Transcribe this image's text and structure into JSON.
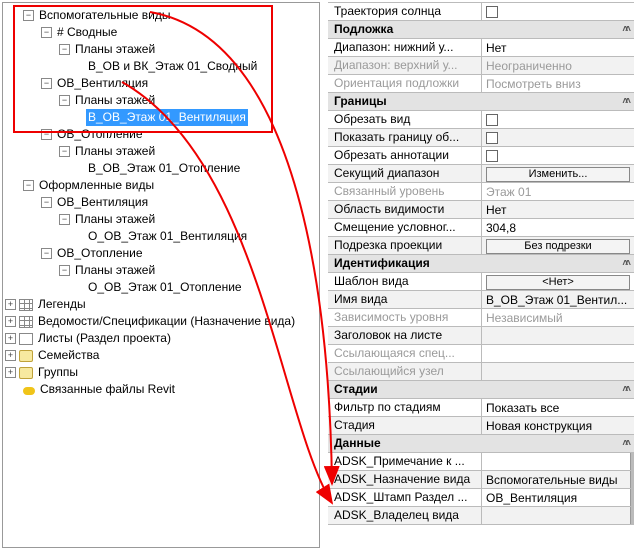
{
  "tree": {
    "n0": "Вспомогательные виды",
    "n1": "# Сводные",
    "n2": "Планы этажей",
    "n3": "В_ОВ и ВК_Этаж 01_Сводный",
    "n4": "ОВ_Вентиляция",
    "n5": "Планы этажей",
    "n6": "В_ОВ_Этаж 01_Вентиляция",
    "n7": "ОВ_Отопление",
    "n8": "Планы этажей",
    "n9": "В_ОВ_Этаж 01_Отопление",
    "n10": "Оформленные виды",
    "n11": "ОВ_Вентиляция",
    "n12": "Планы этажей",
    "n13": "О_ОВ_Этаж 01_Вентиляция",
    "n14": "ОВ_Отопление",
    "n15": "Планы этажей",
    "n16": "О_ОВ_Этаж 01_Отопление",
    "n17": "Легенды",
    "n18": "Ведомости/Спецификации (Назначение вида)",
    "n19": "Листы (Раздел проекта)",
    "n20": "Семейства",
    "n21": "Группы",
    "n22": "Связанные файлы Revit"
  },
  "props": {
    "r0n": "Траектория солнца",
    "r1c": "Подложка",
    "r1n": "Диапазон: нижний у...",
    "r1v": "Нет",
    "r2n": "Диапазон: верхний у...",
    "r2v": "Неограниченно",
    "r3n": "Ориентация подложки",
    "r3v": "Посмотреть вниз",
    "r4c": "Границы",
    "r4n": "Обрезать вид",
    "r5n": "Показать границу об...",
    "r6n": "Обрезать аннотации",
    "r7n": "Секущий диапазон",
    "r7v": "Изменить...",
    "r8n": "Связанный уровень",
    "r8v": "Этаж 01",
    "r9n": "Область видимости",
    "r9v": "Нет",
    "r10n": "Смещение условног...",
    "r10v": "304,8",
    "r11n": "Подрезка проекции",
    "r11v": "Без подрезки",
    "r12c": "Идентификация",
    "r12n": "Шаблон вида",
    "r12v": "<Нет>",
    "r13n": "Имя вида",
    "r13v": "В_ОВ_Этаж 01_Вентил...",
    "r14n": "Зависимость уровня",
    "r14v": "Независимый",
    "r15n": "Заголовок на листе",
    "r16n": "Ссылающаяся спец...",
    "r17n": "Ссылающийся узел",
    "r18c": "Стадии",
    "r18n": "Фильтр по стадиям",
    "r18v": "Показать все",
    "r19n": "Стадия",
    "r19v": "Новая конструкция",
    "r20c": "Данные",
    "r20n": "ADSK_Примечание к ...",
    "r21n": "ADSK_Назначение вида",
    "r21v": "Вспомогательные виды",
    "r22n": "ADSK_Штамп Раздел ...",
    "r22v": "ОВ_Вентиляция",
    "r23n": "ADSK_Владелец вида"
  }
}
